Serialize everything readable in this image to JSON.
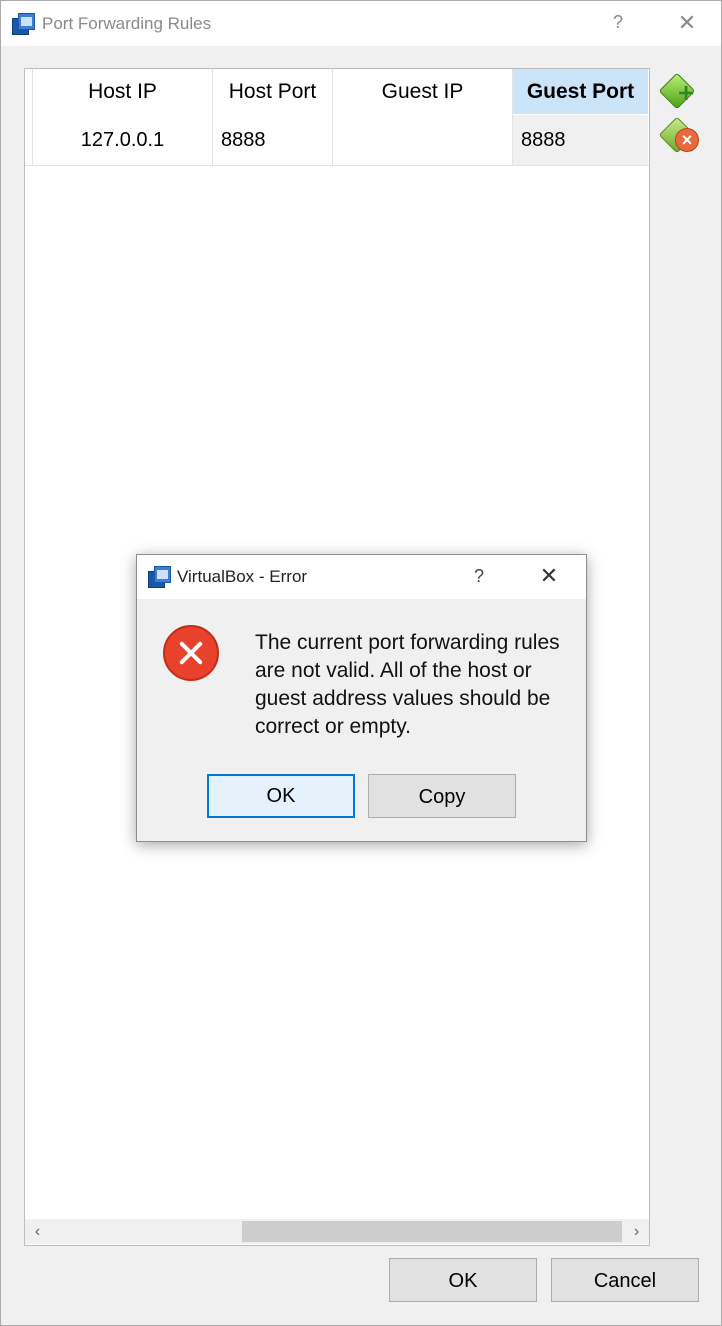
{
  "window": {
    "title": "Port Forwarding Rules",
    "help_glyph": "?",
    "close_glyph": "✕"
  },
  "table": {
    "columns": [
      "Host IP",
      "Host Port",
      "Guest IP",
      "Guest Port"
    ],
    "selected_column": "Guest Port",
    "rows": [
      {
        "host_ip": "127.0.0.1",
        "host_port": "8888",
        "guest_ip": "",
        "guest_port": "8888"
      }
    ],
    "scroll_left_glyph": "‹",
    "scroll_right_glyph": "›"
  },
  "side_buttons": {
    "add_icon": "add-rule-icon",
    "remove_icon": "remove-rule-icon"
  },
  "footer": {
    "ok_label": "OK",
    "cancel_label": "Cancel"
  },
  "error_dialog": {
    "title": "VirtualBox - Error",
    "help_glyph": "?",
    "close_glyph": "✕",
    "message": "The current port forwarding rules are not valid. All of the host or guest address values should be correct or empty.",
    "ok_label": "OK",
    "copy_label": "Copy"
  },
  "colors": {
    "selected_header": "#cce4f7",
    "default_button_border": "#0078d7",
    "error_icon": "#e8412c"
  }
}
